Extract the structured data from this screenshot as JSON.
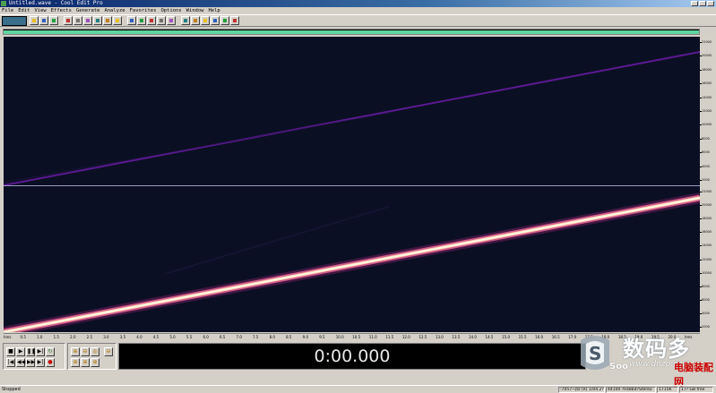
{
  "window": {
    "title": "Untitled.wave - Cool Edit Pro"
  },
  "menu": [
    "File",
    "Edit",
    "View",
    "Effects",
    "Generate",
    "Analyze",
    "Favorites",
    "Options",
    "Window",
    "Help"
  ],
  "toolbar": {
    "icons": [
      "mode-toggle-icon",
      "new-icon",
      "open-icon",
      "save-icon",
      "cut-icon",
      "copy-icon",
      "paste-icon",
      "mix-paste-icon",
      "undo-icon",
      "repeat-icon",
      "waveform-icon",
      "spectral-icon",
      "settings-icon",
      "loop-icon",
      "amplify-icon",
      "eq-icon",
      "noise-icon",
      "reverb-icon",
      "delay-icon",
      "marker-icon",
      "analysis-icon"
    ]
  },
  "spectrogram": {
    "colors": {
      "background": "#0b0f24",
      "upper_sweep": "#6a1a9a",
      "lower_sweep_core": "#fff0d8",
      "lower_sweep_edge": "#d05a8a"
    }
  },
  "scale_right": {
    "upper_labels": [
      "22000",
      "20000",
      "18000",
      "16000",
      "14000",
      "12000",
      "10000",
      "8000",
      "6000",
      "4000",
      "2000"
    ],
    "lower_labels": [
      "22000",
      "20000",
      "18000",
      "16000",
      "14000",
      "12000",
      "10000",
      "8000",
      "6000",
      "4000",
      "2000"
    ]
  },
  "ruler": {
    "labels": [
      "hms",
      "0.5",
      "1.0",
      "1.5",
      "2.0",
      "2.5",
      "3.0",
      "3.5",
      "4.0",
      "4.5",
      "5.0",
      "5.5",
      "6.0",
      "6.5",
      "7.0",
      "7.5",
      "8.0",
      "8.5",
      "9.0",
      "9.5",
      "10.0",
      "10.5",
      "11.0",
      "11.5",
      "12.0",
      "12.5",
      "13.0",
      "13.5",
      "14.0",
      "14.5",
      "15.0",
      "15.5",
      "16.0",
      "16.5",
      "17.0",
      "17.5",
      "18.0",
      "18.5",
      "19.0",
      "19.5",
      "20.0",
      "hms"
    ]
  },
  "transport": {
    "stop": "■",
    "play": "▶",
    "pause": "❚❚",
    "play_to_end": "▶|",
    "loop": "↻",
    "go_start": "|◀",
    "rewind": "◀◀",
    "forward": "▶▶",
    "go_end": "▶|",
    "record": "●"
  },
  "zoom": {
    "icons": [
      "zoom-in-h-icon",
      "zoom-out-h-icon",
      "zoom-full-icon",
      "zoom-in-left-icon",
      "zoom-in-right-icon",
      "zoom-in-v-icon",
      "zoom-out-v-icon"
    ]
  },
  "time_display": "0:00.000",
  "watermark": {
    "cn": "数码多",
    "url": "www.dnzp.com",
    "soo": "Soo",
    "cn2": "电脑装配网"
  },
  "status": {
    "left": "Stopped",
    "cells": [
      "-7057~|tz (R)   1/04.2??",
      "44100 ?Hz8bit?Stereo",
      "1715K",
      "17? GB free"
    ]
  }
}
